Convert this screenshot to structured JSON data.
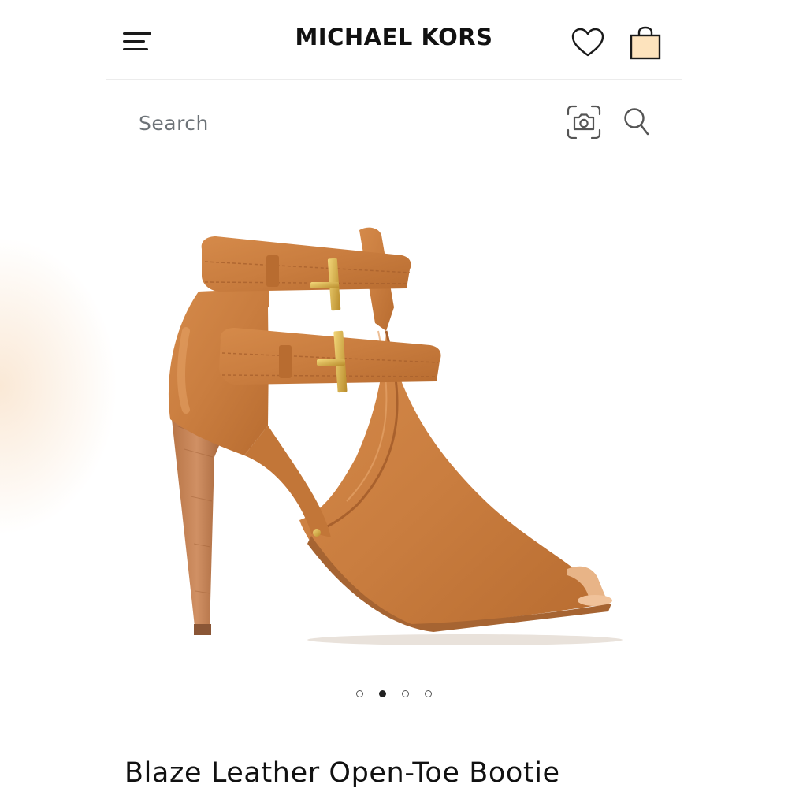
{
  "header": {
    "brand": "MICHAEL KORS",
    "icons": {
      "menu": "menu-icon",
      "wishlist": "heart-icon",
      "bag": "shopping-bag-icon"
    },
    "bag_color": "#fde3bd"
  },
  "search": {
    "placeholder": "Search",
    "icons": {
      "camera": "camera-icon",
      "search": "search-icon"
    }
  },
  "product": {
    "image": "open-toe-bootie-image",
    "title": "Blaze Leather Open-Toe Bootie",
    "leather_color": "#c97d3f",
    "carousel": {
      "total": 4,
      "active_index": 1
    }
  }
}
